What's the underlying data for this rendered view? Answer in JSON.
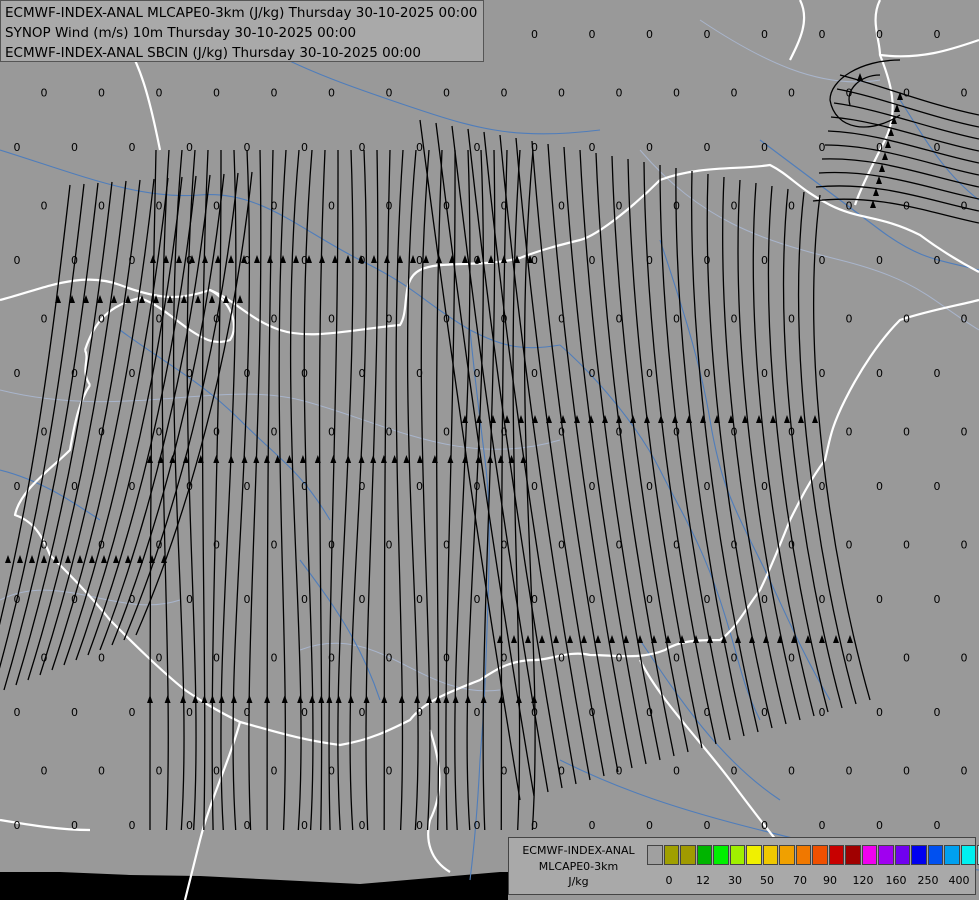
{
  "titles": [
    "ECMWF-INDEX-ANAL MLCAPE0-3km (J/kg) Thursday 30-10-2025 00:00",
    "SYNOP Wind (m/s) 10m Thursday 30-10-2025 00:00",
    "ECMWF-INDEX-ANAL SBCIN (J/kg) Thursday 30-10-2025 00:00"
  ],
  "legend": {
    "lines": [
      "ECMWF-INDEX-ANAL",
      "MLCAPE0-3km",
      "J/kg"
    ],
    "colors": [
      "#a0a0a0",
      "#a0a000",
      "#a09a00",
      "#00b400",
      "#00f000",
      "#a0f000",
      "#f0f000",
      "#f0c800",
      "#f0a000",
      "#f07800",
      "#f05000",
      "#c80000",
      "#a00000",
      "#f000f0",
      "#a000f0",
      "#7000f0",
      "#0000f0",
      "#0050f0",
      "#00a0f0",
      "#00f0f0",
      "#a0f0f0",
      "#ffffff"
    ],
    "ticks": [
      "0",
      "12",
      "30",
      "50",
      "70",
      "90",
      "120",
      "160",
      "250",
      "400"
    ]
  },
  "cin_value": "0",
  "colors": {
    "background": "#999999",
    "borders": "#ffffff",
    "rivers": "#4f7dbb",
    "region_lines": "#a9b5cc",
    "streamlines": "#000000"
  }
}
